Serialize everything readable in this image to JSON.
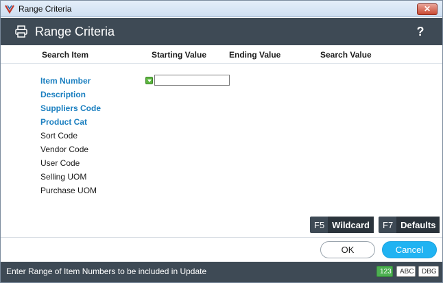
{
  "window": {
    "title": "Range Criteria",
    "close_label": "✕"
  },
  "header": {
    "title": "Range Criteria",
    "help_label": "?"
  },
  "columns": {
    "search_item": "Search Item",
    "starting_value": "Starting Value",
    "ending_value": "Ending Value",
    "search_value": "Search Value"
  },
  "fields": [
    {
      "label": "Item Number",
      "style": "link"
    },
    {
      "label": "Description",
      "style": "link"
    },
    {
      "label": "Suppliers Code",
      "style": "link"
    },
    {
      "label": "Product Cat",
      "style": "link"
    },
    {
      "label": "Sort Code",
      "style": "plain"
    },
    {
      "label": "Vendor Code",
      "style": "plain"
    },
    {
      "label": "User Code",
      "style": "plain"
    },
    {
      "label": "Selling UOM",
      "style": "plain"
    },
    {
      "label": "Purchase UOM",
      "style": "plain"
    }
  ],
  "starting_value_input": {
    "value": ""
  },
  "function_keys": {
    "wildcard": {
      "key": "F5",
      "label": "Wildcard"
    },
    "defaults": {
      "key": "F7",
      "label": "Defaults"
    }
  },
  "buttons": {
    "ok": "OK",
    "cancel": "Cancel"
  },
  "status": {
    "message": "Enter Range of Item Numbers to be included in Update",
    "badges": [
      "123",
      "ABC",
      "DBG"
    ]
  },
  "colors": {
    "header_bg": "#3e4a55",
    "link_text": "#1a7fc0",
    "cancel_bg": "#20b3f2",
    "num_badge": "#4caf50"
  }
}
